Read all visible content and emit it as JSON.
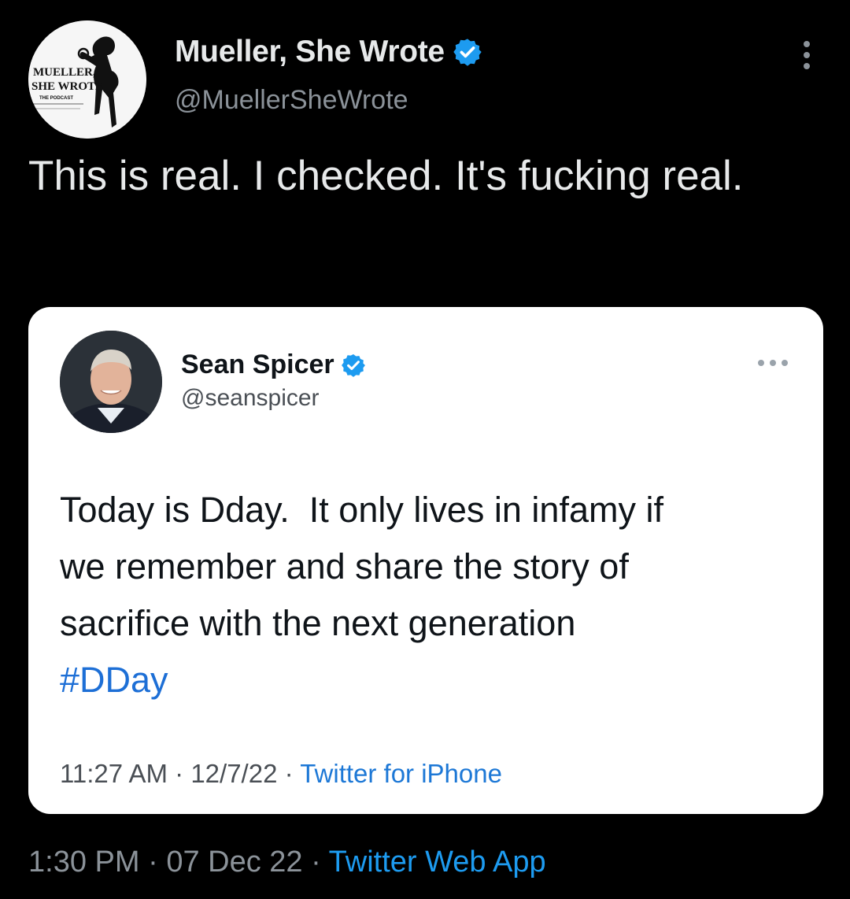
{
  "outer_tweet": {
    "author": {
      "name": "Mueller, She Wrote",
      "handle": "@MuellerSheWrote",
      "avatar_text_line1": "MUELLER,",
      "avatar_text_line2": "SHE WROTE",
      "avatar_text_line3": "THE PODCAST",
      "verified": true
    },
    "text": "This is real. I checked. It's fucking real.",
    "time": "1:30 PM",
    "date": "07 Dec 22",
    "separator": "·",
    "source": "Twitter Web App"
  },
  "quoted_screenshot": {
    "author": {
      "name": "Sean Spicer",
      "handle": "@seanspicer",
      "verified": true
    },
    "text_line1": "Today is Dday.  It only lives in infamy if",
    "text_line2": "we remember and share the story of",
    "text_line3": "sacrifice with the next generation",
    "hashtag": "#DDay",
    "time": "11:27 AM",
    "date": "12/7/22",
    "separator": "·",
    "source": "Twitter for iPhone"
  },
  "icons": {
    "verified": "verified-badge-icon",
    "more": "more-options-icon"
  },
  "colors": {
    "background": "#000000",
    "link_blue": "#1d9bf0",
    "verified_blue": "#1d9bf0"
  }
}
